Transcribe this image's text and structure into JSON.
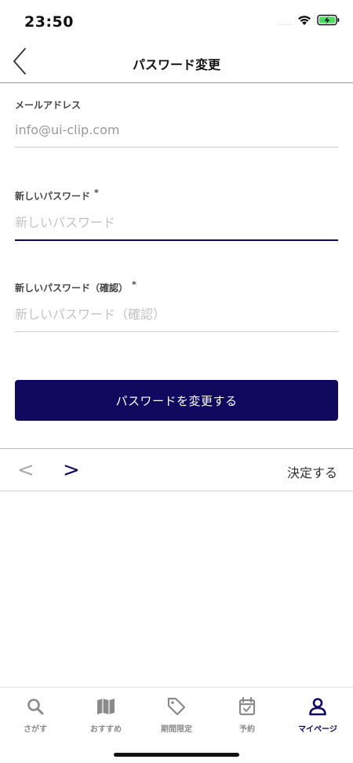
{
  "status_bar": {
    "time": "23:50",
    "signal_dots": "....",
    "icons": [
      "wifi-icon",
      "battery-charging-icon"
    ]
  },
  "nav": {
    "title": "パスワード変更",
    "back_icon": "chevron-left-icon"
  },
  "form": {
    "email": {
      "label": "メールアドレス",
      "value": "info@ui-clip.com"
    },
    "new_password": {
      "label": "新しいパスワード",
      "required_mark": "*",
      "placeholder": "新しいパスワード"
    },
    "confirm_password": {
      "label": "新しいパスワード（確認）",
      "required_mark": "*",
      "placeholder": "新しいパスワード（確認）"
    },
    "submit_label": "パスワードを変更する"
  },
  "keyboard_toolbar": {
    "prev_label": "<",
    "next_label": ">",
    "done_label": "決定する"
  },
  "tab_bar": {
    "items": [
      {
        "label": "さがす",
        "icon": "search-icon"
      },
      {
        "label": "おすすめ",
        "icon": "map-icon"
      },
      {
        "label": "期間限定",
        "icon": "tag-icon"
      },
      {
        "label": "予約",
        "icon": "calendar-check-icon"
      },
      {
        "label": "マイページ",
        "icon": "person-icon"
      }
    ],
    "active_index": 4
  },
  "colors": {
    "accent": "#10095e",
    "inactive": "#8a8a8a"
  }
}
